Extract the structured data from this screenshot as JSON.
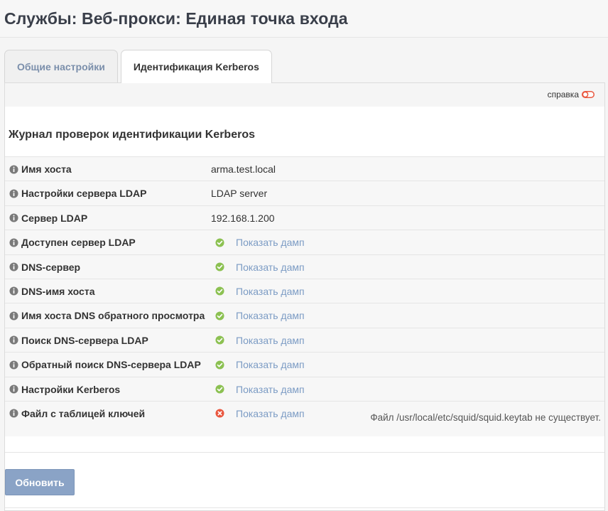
{
  "page": {
    "title": "Службы: Веб-прокси: Единая точка входа"
  },
  "tabs": [
    {
      "label": "Общие настройки",
      "active": false
    },
    {
      "label": "Идентификация Kerberos",
      "active": true
    }
  ],
  "help": {
    "label": "справка"
  },
  "section": {
    "title": "Журнал проверок идентификации Kerberos"
  },
  "rows": [
    {
      "label": "Имя хоста",
      "value": "arma.test.local"
    },
    {
      "label": "Настройки сервера LDAP",
      "value": "LDAP server"
    },
    {
      "label": "Сервер LDAP",
      "value": "192.168.1.200"
    },
    {
      "label": "Доступен сервер LDAP",
      "status": "ok",
      "link": "Показать дамп"
    },
    {
      "label": "DNS-сервер",
      "status": "ok",
      "link": "Показать дамп"
    },
    {
      "label": "DNS-имя хоста",
      "status": "ok",
      "link": "Показать дамп"
    },
    {
      "label": "Имя хоста DNS обратного просмотра",
      "status": "ok",
      "link": "Показать дамп"
    },
    {
      "label": "Поиск DNS-сервера LDAP",
      "status": "ok",
      "link": "Показать дамп"
    },
    {
      "label": "Обратный поиск DNS-сервера LDAP",
      "status": "ok",
      "link": "Показать дамп"
    },
    {
      "label": "Настройки Kerberos",
      "status": "ok",
      "link": "Показать дамп"
    },
    {
      "label": "Файл с таблицей ключей",
      "status": "error",
      "link": "Показать дамп",
      "note": "Файл /usr/local/etc/squid/squid.keytab не существует."
    }
  ],
  "actions": {
    "refresh_label": "Обновить"
  },
  "colors": {
    "ok": "#8cc152",
    "error": "#e9573f",
    "info": "#7a7a7a",
    "link": "#7b9bc4",
    "button": "#8aa3c6"
  }
}
